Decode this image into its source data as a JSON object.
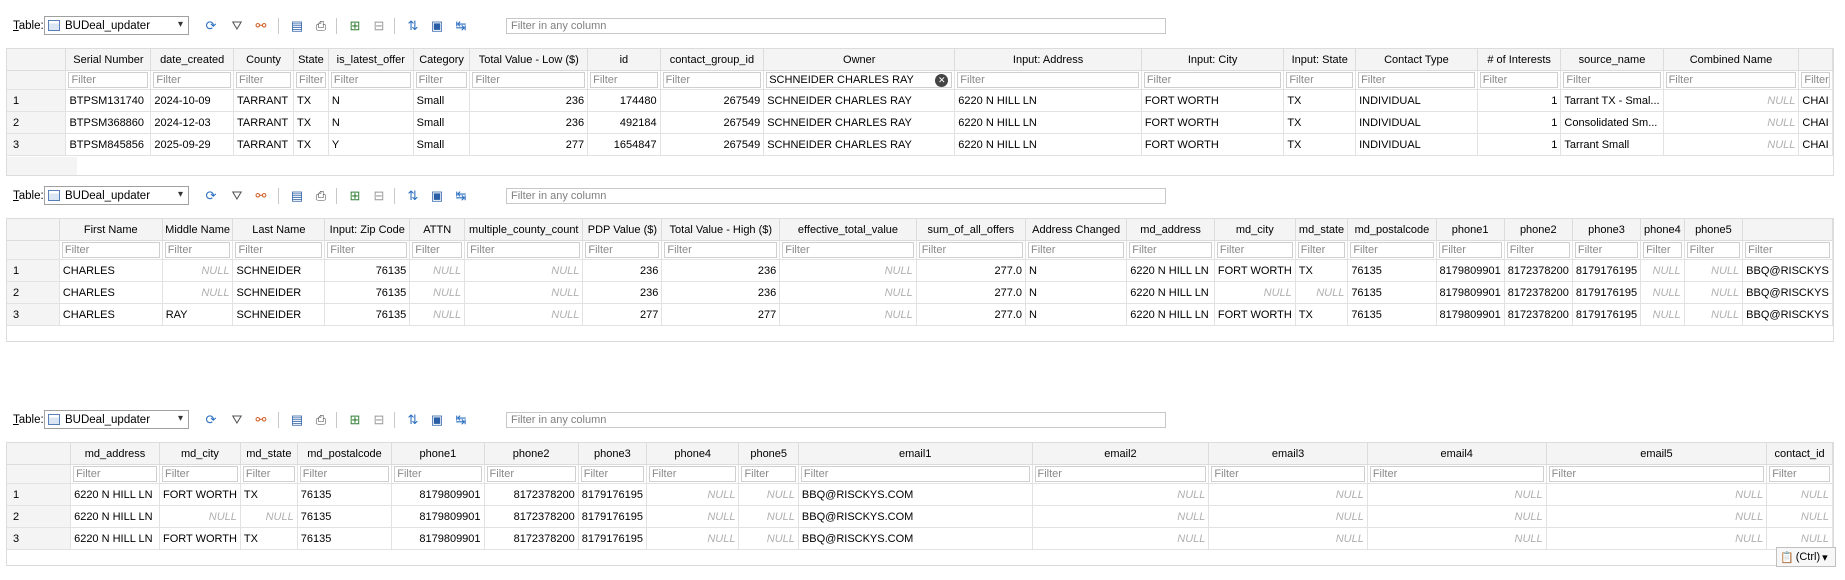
{
  "toolbar": {
    "table_label": "Table:",
    "table_name": "BUDeal_updater",
    "filter_placeholder": "Filter in any column"
  },
  "filter_placeholder": "Filter",
  "null_text": "NULL",
  "grid1": {
    "owner_filter_value": "SCHNEIDER CHARLES RAY",
    "columns": [
      "Serial Number",
      "date_created",
      "County",
      "State",
      "is_latest_offer",
      "Category",
      "Total Value - Low ($)",
      "id",
      "contact_group_id",
      "Owner",
      "Input: Address",
      "Input: City",
      "Input: State",
      "Contact Type",
      "# of Interests",
      "source_name",
      "Combined Name",
      ""
    ],
    "rows": [
      {
        "n": "1",
        "c": [
          "BTPSM131740",
          "2024-10-09",
          "TARRANT",
          "TX",
          "N",
          "Small",
          "236",
          "174480",
          "267549",
          "SCHNEIDER CHARLES RAY",
          "6220 N HILL LN",
          "FORT WORTH",
          "TX",
          "INDIVIDUAL",
          "1",
          "Tarrant TX - Smal...",
          "NULL",
          "CHAI"
        ]
      },
      {
        "n": "2",
        "c": [
          "BTPSM368860",
          "2024-12-03",
          "TARRANT",
          "TX",
          "N",
          "Small",
          "236",
          "492184",
          "267549",
          "SCHNEIDER CHARLES RAY",
          "6220 N HILL LN",
          "FORT WORTH",
          "TX",
          "INDIVIDUAL",
          "1",
          "Consolidated Sm...",
          "NULL",
          "CHAI"
        ]
      },
      {
        "n": "3",
        "c": [
          "BTPSM845856",
          "2025-09-29",
          "TARRANT",
          "TX",
          "Y",
          "Small",
          "277",
          "1654847",
          "267549",
          "SCHNEIDER CHARLES RAY",
          "6220 N HILL LN",
          "FORT WORTH",
          "TX",
          "INDIVIDUAL",
          "1",
          "Tarrant Small",
          "NULL",
          "CHAI"
        ]
      }
    ]
  },
  "grid2": {
    "columns": [
      "First Name",
      "Middle Name",
      "Last Name",
      "Input: Zip Code",
      "ATTN",
      "multiple_county_count",
      "PDP Value ($)",
      "Total Value - High ($)",
      "effective_total_value",
      "sum_of_all_offers",
      "Address Changed",
      "md_address",
      "md_city",
      "md_state",
      "md_postalcode",
      "phone1",
      "phone2",
      "phone3",
      "phone4",
      "phone5",
      ""
    ],
    "rows": [
      {
        "n": "1",
        "c": [
          "CHARLES",
          "NULL",
          "SCHNEIDER",
          "76135",
          "NULL",
          "NULL",
          "236",
          "236",
          "NULL",
          "277.0",
          "N",
          "6220 N HILL LN",
          "FORT WORTH",
          "TX",
          "76135",
          "8179809901",
          "8172378200",
          "8179176195",
          "NULL",
          "NULL",
          "BBQ@RISCKYS"
        ]
      },
      {
        "n": "2",
        "c": [
          "CHARLES",
          "NULL",
          "SCHNEIDER",
          "76135",
          "NULL",
          "NULL",
          "236",
          "236",
          "NULL",
          "277.0",
          "N",
          "6220 N HILL LN",
          "NULL",
          "NULL",
          "76135",
          "8179809901",
          "8172378200",
          "8179176195",
          "NULL",
          "NULL",
          "BBQ@RISCKYS"
        ]
      },
      {
        "n": "3",
        "c": [
          "CHARLES",
          "RAY",
          "SCHNEIDER",
          "76135",
          "NULL",
          "NULL",
          "277",
          "277",
          "NULL",
          "277.0",
          "N",
          "6220 N HILL LN",
          "FORT WORTH",
          "TX",
          "76135",
          "8179809901",
          "8172378200",
          "8179176195",
          "NULL",
          "NULL",
          "BBQ@RISCKYS"
        ]
      }
    ]
  },
  "grid3": {
    "columns": [
      "md_address",
      "md_city",
      "md_state",
      "md_postalcode",
      "phone1",
      "phone2",
      "phone3",
      "phone4",
      "phone5",
      "email1",
      "email2",
      "email3",
      "email4",
      "email5",
      "contact_id"
    ],
    "rows": [
      {
        "n": "1",
        "c": [
          "6220 N HILL LN",
          "FORT WORTH",
          "TX",
          "76135",
          "8179809901",
          "8172378200",
          "8179176195",
          "NULL",
          "NULL",
          "BBQ@RISCKYS.COM",
          "NULL",
          "NULL",
          "NULL",
          "NULL",
          "NULL"
        ]
      },
      {
        "n": "2",
        "c": [
          "6220 N HILL LN",
          "NULL",
          "NULL",
          "76135",
          "8179809901",
          "8172378200",
          "8179176195",
          "NULL",
          "NULL",
          "BBQ@RISCKYS.COM",
          "NULL",
          "NULL",
          "NULL",
          "NULL",
          "NULL"
        ]
      },
      {
        "n": "3",
        "c": [
          "6220 N HILL LN",
          "FORT WORTH",
          "TX",
          "76135",
          "8179809901",
          "8172378200",
          "8179176195",
          "NULL",
          "NULL",
          "BBQ@RISCKYS.COM",
          "NULL",
          "NULL",
          "NULL",
          "NULL",
          "NULL"
        ]
      }
    ]
  },
  "paste_label": "(Ctrl)"
}
